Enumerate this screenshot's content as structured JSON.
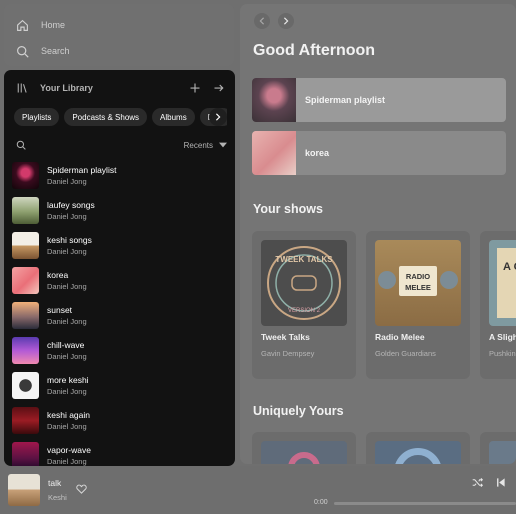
{
  "nav": {
    "home_label": "Home",
    "search_label": "Search"
  },
  "library": {
    "title": "Your Library",
    "chips": [
      "Playlists",
      "Podcasts & Shows",
      "Albums",
      "Dow"
    ],
    "sort_label": "Recents",
    "items": [
      {
        "name": "Spiderman playlist",
        "owner": "Daniel Jong"
      },
      {
        "name": "laufey songs",
        "owner": "Daniel Jong"
      },
      {
        "name": "keshi songs",
        "owner": "Daniel Jong"
      },
      {
        "name": "korea",
        "owner": "Daniel Jong"
      },
      {
        "name": "sunset",
        "owner": "Daniel Jong"
      },
      {
        "name": "chill-wave",
        "owner": "Daniel Jong"
      },
      {
        "name": "more keshi",
        "owner": "Daniel Jong"
      },
      {
        "name": "keshi again",
        "owner": "Daniel Jong"
      },
      {
        "name": "vapor-wave",
        "owner": "Daniel Jong"
      }
    ]
  },
  "main": {
    "greeting": "Good Afternoon",
    "quick": [
      {
        "name": "Spiderman playlist"
      },
      {
        "name": "korea"
      }
    ],
    "shows_title": "Your shows",
    "shows": [
      {
        "title": "Tweek Talks",
        "sub": "Gavin Dempsey",
        "art_top": "TWEEK TALKS",
        "art_bottom": "VERSION 2"
      },
      {
        "title": "Radio Melee",
        "sub": "Golden Guardians",
        "art_top": "RADIO",
        "art_bottom": "MELEE"
      },
      {
        "title": "A Sligh Plans",
        "sub": "Pushkin",
        "art_top": "A CH P"
      }
    ],
    "uniquely_title": "Uniquely Yours"
  },
  "player": {
    "title": "talk",
    "artist": "Keshi",
    "time": "0:00"
  }
}
